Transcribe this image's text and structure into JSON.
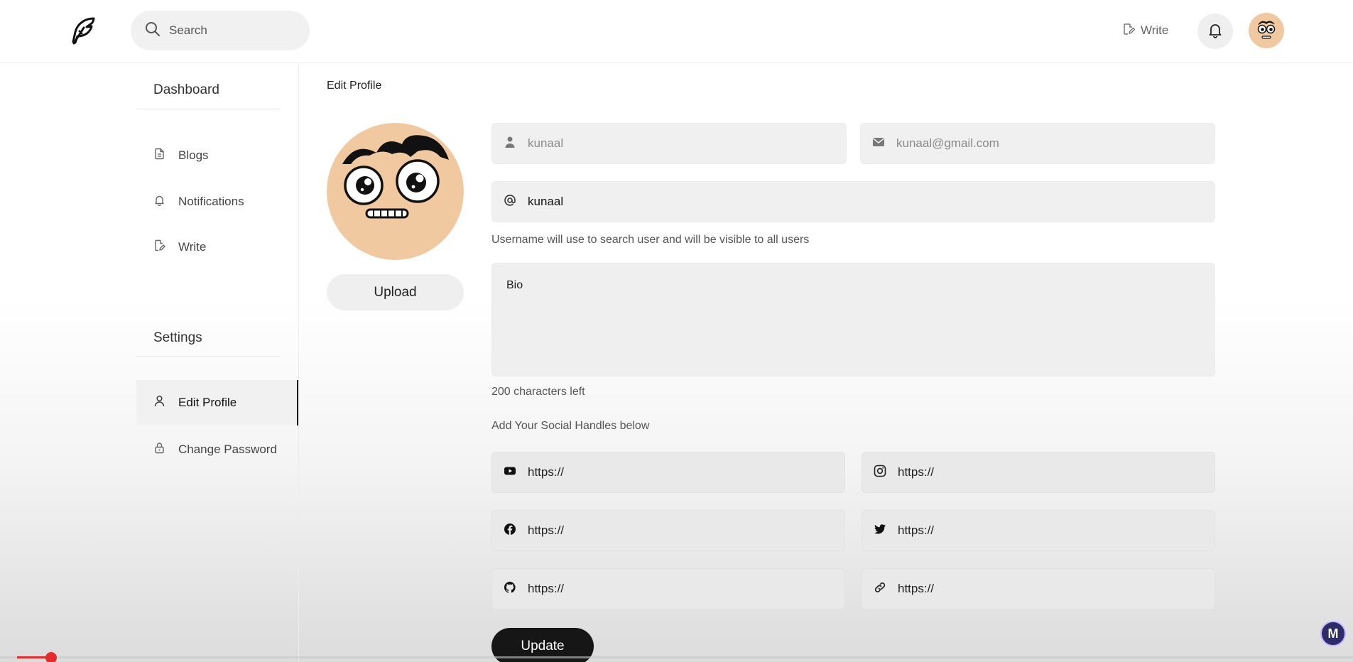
{
  "navbar": {
    "search_placeholder": "Search",
    "write_label": "Write"
  },
  "sidebar": {
    "dashboard_heading": "Dashboard",
    "dashboard_items": [
      {
        "label": "Blogs",
        "icon": "file-icon"
      },
      {
        "label": "Notifications",
        "icon": "bell-icon"
      },
      {
        "label": "Write",
        "icon": "edit-icon"
      }
    ],
    "settings_heading": "Settings",
    "settings_items": [
      {
        "label": "Edit Profile",
        "icon": "user-icon",
        "active": true
      },
      {
        "label": "Change Password",
        "icon": "lock-icon",
        "active": false
      }
    ]
  },
  "main": {
    "title": "Edit Profile",
    "upload_label": "Upload",
    "fullname_value": "kunaal",
    "email_value": "kunaal@gmail.com",
    "username_value": "kunaal",
    "username_hint": "Username will use to search user and will be visible to all users",
    "bio_placeholder": "Bio",
    "chars_left": "200 characters left",
    "social_heading": "Add Your Social Handles below",
    "social": {
      "youtube": "https://",
      "instagram": "https://",
      "facebook": "https://",
      "twitter": "https://",
      "github": "https://",
      "website": "https://"
    },
    "update_label": "Update"
  },
  "overlay": {
    "channel_badge": "M",
    "progress": 0.04
  },
  "colors": {
    "accent_dark": "#161616",
    "field_bg": "#f0f0f0",
    "avatar_skin": "#f0c9a0",
    "progress_red": "#e52b2b"
  }
}
